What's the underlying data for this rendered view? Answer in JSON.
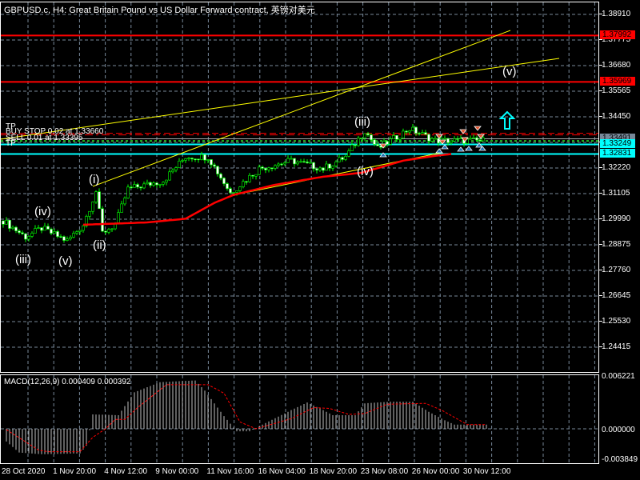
{
  "title": "GBPUSD.c, H4:  Great Britain Pound vs US Dollar Forward contract, 英镑对美元",
  "price_axis": [
    "1.38910",
    "1.37775",
    "1.36680",
    "1.35565",
    "1.34450",
    "1.33335",
    "1.32220",
    "1.31105",
    "1.29990",
    "1.28875",
    "1.27760",
    "1.26645",
    "1.25530",
    "1.24415"
  ],
  "price_labels": [
    {
      "text": "1.37992",
      "price": 1.37992,
      "bg": "#ff0000",
      "fg": "#000000"
    },
    {
      "text": "1.35969",
      "price": 1.35969,
      "bg": "#ff0000",
      "fg": "#000000"
    },
    {
      "text": "1.33491",
      "price": 1.33491,
      "bg": "#778899",
      "fg": "#000000"
    },
    {
      "text": "1.33249",
      "price": 1.33249,
      "bg": "#00ffff",
      "fg": "#000000"
    },
    {
      "text": "1.32831",
      "price": 1.32831,
      "bg": "#00ffff",
      "fg": "#000000"
    }
  ],
  "orders": {
    "tp1": "TP",
    "buy_stop": "BUY STOP 0.02 at 1.33660",
    "sell": "SELL 0.01 at 1.33395",
    "tp2": "TP"
  },
  "waves": [
    "(iii)",
    "(iv)",
    "(v)",
    "(i)",
    "(ii)",
    "(iii)",
    "(iv)",
    "(v)"
  ],
  "macd": {
    "label": "MACD(12,26,9) 0.000409 0.000392",
    "axis": [
      "0.006221",
      "0.000000",
      "-0.003849"
    ],
    "hist": [
      [
        1,
        -0.0015
      ],
      [
        5,
        -0.0028
      ],
      [
        12,
        -0.003
      ],
      [
        24,
        -0.0029
      ],
      [
        26,
        -0.002
      ],
      [
        28,
        0.0017
      ],
      [
        36,
        0.0016
      ],
      [
        41,
        0.0043
      ],
      [
        49,
        0.0055
      ],
      [
        60,
        0.0057
      ],
      [
        63,
        0.0045
      ],
      [
        69,
        0.0015
      ],
      [
        73,
        -0.0003
      ],
      [
        77,
        -0.0003
      ],
      [
        80,
        0.0003
      ],
      [
        90,
        0.0022
      ],
      [
        95,
        0.0031
      ],
      [
        99,
        0.0024
      ],
      [
        103,
        0.0016
      ],
      [
        110,
        0.0016
      ],
      [
        113,
        0.003
      ],
      [
        121,
        0.0032
      ],
      [
        128,
        0.0032
      ],
      [
        133,
        0.002
      ],
      [
        138,
        0.001
      ],
      [
        141,
        0.0005
      ],
      [
        151,
        0.0005
      ]
    ],
    "signal": [
      [
        1,
        -0.0001
      ],
      [
        11,
        -0.0025
      ],
      [
        14,
        -0.0027
      ],
      [
        24,
        -0.0027
      ],
      [
        28,
        -0.001
      ],
      [
        32,
        0.0
      ],
      [
        35,
        0.0011
      ],
      [
        38,
        0.0011
      ],
      [
        42,
        0.0025
      ],
      [
        51,
        0.0052
      ],
      [
        64,
        0.0052
      ],
      [
        69,
        0.0042
      ],
      [
        74,
        0.0008
      ],
      [
        79,
        0.0
      ],
      [
        90,
        0.0012
      ],
      [
        97,
        0.0025
      ],
      [
        102,
        0.0024
      ],
      [
        108,
        0.0017
      ],
      [
        113,
        0.0018
      ],
      [
        120,
        0.0029
      ],
      [
        132,
        0.003
      ],
      [
        137,
        0.0022
      ],
      [
        145,
        0.0005
      ],
      [
        151,
        0.0005
      ]
    ]
  },
  "price_path": [
    [
      0,
      1.2992
    ],
    [
      7,
      1.2922
    ],
    [
      12,
      1.296
    ],
    [
      20,
      1.2905
    ],
    [
      25,
      1.2975
    ],
    [
      29,
      1.3121
    ],
    [
      31,
      1.294
    ],
    [
      35,
      1.2975
    ],
    [
      39,
      1.3131
    ],
    [
      50,
      1.3166
    ],
    [
      57,
      1.3271
    ],
    [
      64,
      1.3271
    ],
    [
      71,
      1.3114
    ],
    [
      80,
      1.3219
    ],
    [
      90,
      1.3254
    ],
    [
      100,
      1.3219
    ],
    [
      107,
      1.3271
    ],
    [
      113,
      1.3386
    ],
    [
      117,
      1.3306
    ],
    [
      127,
      1.3393
    ],
    [
      135,
      1.3341
    ],
    [
      150,
      1.3341
    ]
  ],
  "ma_path": [
    [
      25,
      1.2975
    ],
    [
      45,
      1.2985
    ],
    [
      57,
      1.3001
    ],
    [
      66,
      1.307
    ],
    [
      72,
      1.3105
    ],
    [
      85,
      1.3149
    ],
    [
      100,
      1.3184
    ],
    [
      112,
      1.3201
    ],
    [
      125,
      1.3254
    ],
    [
      135,
      1.3275
    ],
    [
      140,
      1.3283
    ]
  ],
  "dates": [
    "28 Oct 2020",
    "1 Nov 20:00",
    "4 Nov 12:00",
    "9 Nov 00:00",
    "11 Nov 16:00",
    "16 Nov 04:00",
    "18 Nov 20:00",
    "23 Nov 08:00",
    "26 Nov 00:00",
    "30 Nov 12:00"
  ],
  "colors": {
    "bull": "#00ff00",
    "bear": "#ffffff",
    "ma": "#ff0000",
    "trend": "#ffff00",
    "support": "#00ffff",
    "resistance": "#ff0000",
    "grid": "#778899"
  }
}
